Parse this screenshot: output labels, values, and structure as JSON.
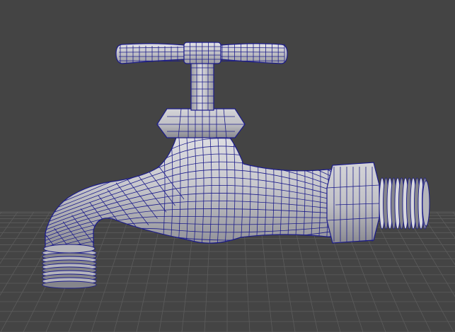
{
  "viewport": {
    "view": "perspective",
    "display_mode": "wireframe-on-shaded",
    "grid": true,
    "colors": {
      "background": "#444444",
      "grid_line": "#5c5c5c",
      "wireframe": "#1c1c8a",
      "surface_light": "#d8d8dc",
      "surface_mid": "#b5b5bb",
      "surface_dark": "#86868c"
    }
  },
  "model": {
    "object": "water-faucet",
    "icon": "faucet-icon",
    "parts": [
      "t-handle",
      "stem",
      "hex-bonnet",
      "body",
      "spout",
      "outlet-thread",
      "hex-nut",
      "inlet-thread"
    ]
  }
}
